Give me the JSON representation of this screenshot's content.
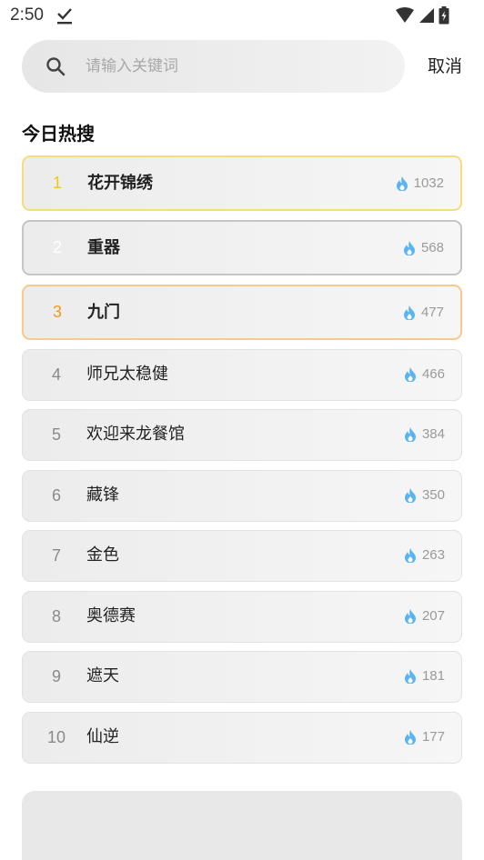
{
  "status_bar": {
    "time": "2:50"
  },
  "search": {
    "placeholder": "请输入关键词",
    "value": "",
    "cancel_label": "取消"
  },
  "section_title": "今日热搜",
  "hot_list": [
    {
      "rank": "1",
      "title": "花开锦绣",
      "heat": "1032"
    },
    {
      "rank": "2",
      "title": "重器",
      "heat": "568"
    },
    {
      "rank": "3",
      "title": "九门",
      "heat": "477"
    },
    {
      "rank": "4",
      "title": "师兄太稳健",
      "heat": "466"
    },
    {
      "rank": "5",
      "title": "欢迎来龙餐馆",
      "heat": "384"
    },
    {
      "rank": "6",
      "title": "藏锋",
      "heat": "350"
    },
    {
      "rank": "7",
      "title": "金色",
      "heat": "263"
    },
    {
      "rank": "8",
      "title": "奥德赛",
      "heat": "207"
    },
    {
      "rank": "9",
      "title": "遮天",
      "heat": "181"
    },
    {
      "rank": "10",
      "title": "仙逆",
      "heat": "177"
    }
  ],
  "icons": {
    "flame": "flame-icon",
    "search": "search-icon"
  },
  "colors": {
    "rank1": "#f5c518",
    "rank3": "#f39a1e",
    "flame": "#5bb4f0"
  }
}
